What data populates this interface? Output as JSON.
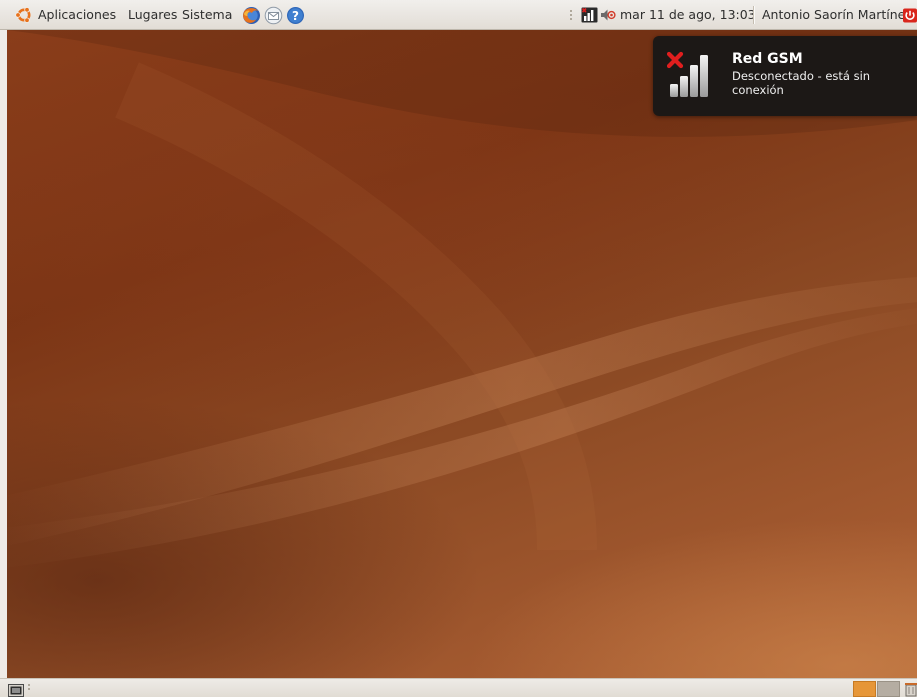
{
  "top_panel": {
    "menus": {
      "applications": "Aplicaciones",
      "places": "Lugares",
      "system": "Sistema"
    },
    "launchers": {
      "browser_icon": "firefox-icon",
      "mail_icon": "evolution-mail-icon",
      "help_icon": "help-icon"
    },
    "clock": "mar 11 de ago, 13:03",
    "user": "Antonio Saorín Martínez",
    "tray_icons": [
      "network-status-icon",
      "volume-icon"
    ],
    "power_icon": "shutdown-icon"
  },
  "notification": {
    "icon": "gsm-signal-disconnected-icon",
    "title": "Red GSM",
    "body": "Desconectado - está sin conexión"
  },
  "bottom_panel": {
    "show_desktop_icon": "show-desktop-icon",
    "workspaces": [
      {
        "active": true,
        "color": "#e69638"
      },
      {
        "active": false,
        "color": "#b5ada2"
      }
    ],
    "trash_icon": "trash-icon"
  },
  "colors": {
    "panel": "#e9e5df",
    "wallpaper": "#8a3d1a",
    "notification_bg": "#161616",
    "accent_orange": "#e69638"
  }
}
